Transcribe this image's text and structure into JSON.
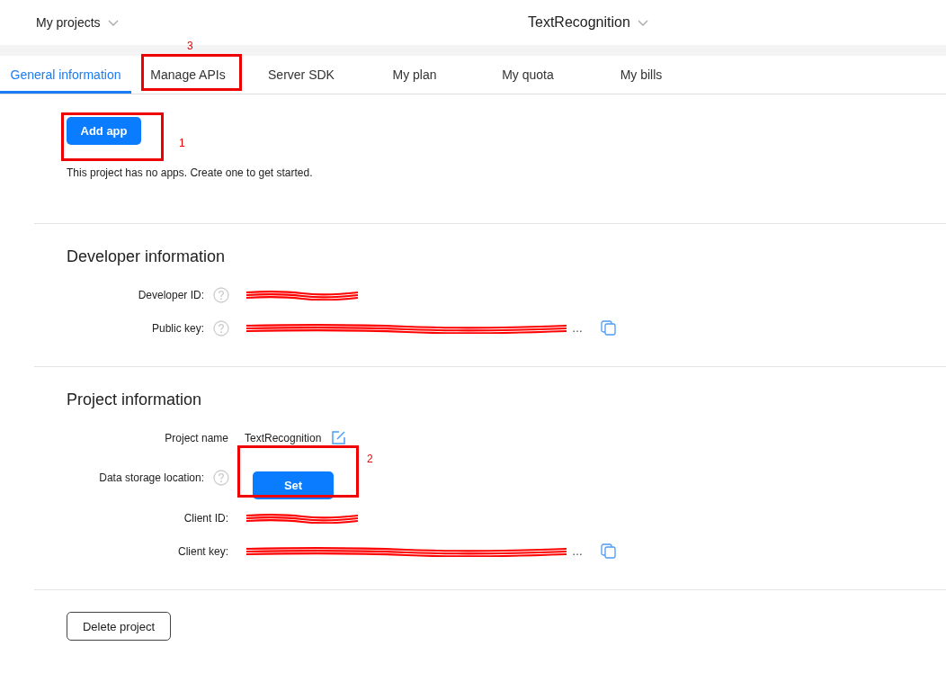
{
  "header": {
    "project_menu": "My projects",
    "app_menu": "TextRecognition"
  },
  "tabs": [
    {
      "label": "General information",
      "selected": true
    },
    {
      "label": "Manage APIs",
      "selected": false,
      "annotation": "3"
    },
    {
      "label": "Server SDK",
      "selected": false
    },
    {
      "label": "My plan",
      "selected": false
    },
    {
      "label": "My quota",
      "selected": false
    },
    {
      "label": "My bills",
      "selected": false
    }
  ],
  "apps": {
    "add_button": "Add app",
    "annotation": "1",
    "empty_message": "This project has no apps. Create one to get started."
  },
  "sections": [
    {
      "title": "Developer information",
      "rows": [
        {
          "label": "Developer ID:",
          "kind": "redacted",
          "help": true,
          "copy": false
        },
        {
          "label": "Public key:",
          "kind": "redacted",
          "help": true,
          "truncation": "…",
          "copy": true
        }
      ]
    },
    {
      "title": "Project information",
      "rows": [
        {
          "label": "Project name",
          "kind": "text",
          "value": "TextRecognition",
          "help": false,
          "editable": true
        },
        {
          "label": "Data storage location:",
          "kind": "button",
          "action": "Set",
          "help": true,
          "annotation": "2"
        },
        {
          "label": "Client ID:",
          "kind": "redacted",
          "help": false,
          "copy": false
        },
        {
          "label": "Client key:",
          "kind": "redacted",
          "help": false,
          "truncation": "…",
          "copy": true
        }
      ]
    }
  ],
  "delete_button": "Delete project"
}
